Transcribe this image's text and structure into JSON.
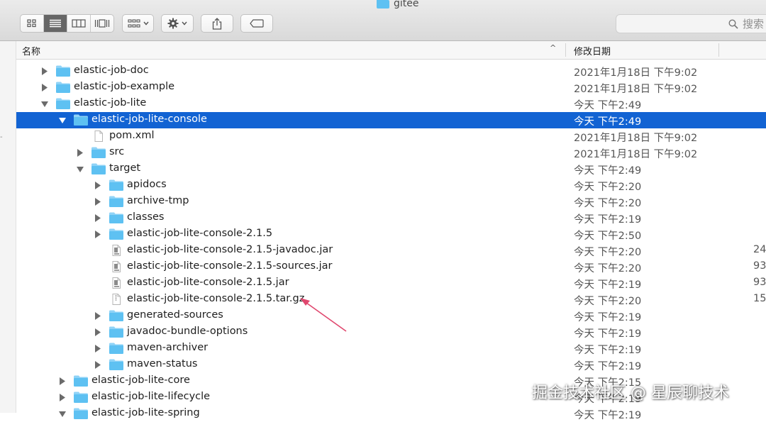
{
  "window": {
    "title": "gitee"
  },
  "toolbar": {
    "view_buttons": [
      {
        "name": "icon-view-button",
        "icon": "grid-icon",
        "active": false
      },
      {
        "name": "list-view-button",
        "icon": "list-icon",
        "active": true
      },
      {
        "name": "column-view-button",
        "icon": "columns-icon",
        "active": false
      },
      {
        "name": "gallery-view-button",
        "icon": "gallery-icon",
        "active": false
      }
    ],
    "group_button_icon": "group-icon",
    "action_button_icon": "gear-icon",
    "share_button_icon": "share-icon",
    "tag_button_icon": "tag-icon"
  },
  "search": {
    "placeholder": "搜索"
  },
  "header": {
    "name_label": "名称",
    "date_label": "修改日期",
    "sort_indicator": "^"
  },
  "colors": {
    "selection": "#1263d3",
    "folder": "#5ec1f2",
    "folder_tab": "#8fd3f7"
  },
  "rows": [
    {
      "name": "elastic-job-doc",
      "date": "2021年1月18日 下午9:02",
      "kind": "folder",
      "depth": 0,
      "disclosure": "collapsed",
      "selected": false,
      "size": ""
    },
    {
      "name": "elastic-job-example",
      "date": "2021年1月18日 下午9:02",
      "kind": "folder",
      "depth": 0,
      "disclosure": "collapsed",
      "selected": false,
      "size": ""
    },
    {
      "name": "elastic-job-lite",
      "date": "今天 下午2:49",
      "kind": "folder",
      "depth": 0,
      "disclosure": "expanded",
      "selected": false,
      "size": ""
    },
    {
      "name": "elastic-job-lite-console",
      "date": "今天 下午2:49",
      "kind": "folder",
      "depth": 1,
      "disclosure": "expanded",
      "selected": true,
      "size": ""
    },
    {
      "name": "pom.xml",
      "date": "2021年1月18日 下午9:02",
      "kind": "file",
      "depth": 2,
      "disclosure": "none",
      "selected": false,
      "size": ""
    },
    {
      "name": "src",
      "date": "2021年1月18日 下午9:02",
      "kind": "folder",
      "depth": 2,
      "disclosure": "collapsed",
      "selected": false,
      "size": ""
    },
    {
      "name": "target",
      "date": "今天 下午2:49",
      "kind": "folder",
      "depth": 2,
      "disclosure": "expanded",
      "selected": false,
      "size": ""
    },
    {
      "name": "apidocs",
      "date": "今天 下午2:20",
      "kind": "folder",
      "depth": 3,
      "disclosure": "collapsed",
      "selected": false,
      "size": ""
    },
    {
      "name": "archive-tmp",
      "date": "今天 下午2:20",
      "kind": "folder",
      "depth": 3,
      "disclosure": "collapsed",
      "selected": false,
      "size": ""
    },
    {
      "name": "classes",
      "date": "今天 下午2:19",
      "kind": "folder",
      "depth": 3,
      "disclosure": "collapsed",
      "selected": false,
      "size": ""
    },
    {
      "name": "elastic-job-lite-console-2.1.5",
      "date": "今天 下午2:50",
      "kind": "folder",
      "depth": 3,
      "disclosure": "collapsed",
      "selected": false,
      "size": ""
    },
    {
      "name": "elastic-job-lite-console-2.1.5-javadoc.jar",
      "date": "今天 下午2:20",
      "kind": "jar",
      "depth": 3,
      "disclosure": "none",
      "selected": false,
      "size": "24"
    },
    {
      "name": "elastic-job-lite-console-2.1.5-sources.jar",
      "date": "今天 下午2:20",
      "kind": "jar",
      "depth": 3,
      "disclosure": "none",
      "selected": false,
      "size": "93"
    },
    {
      "name": "elastic-job-lite-console-2.1.5.jar",
      "date": "今天 下午2:19",
      "kind": "jar",
      "depth": 3,
      "disclosure": "none",
      "selected": false,
      "size": "93"
    },
    {
      "name": "elastic-job-lite-console-2.1.5.tar.gz",
      "date": "今天 下午2:20",
      "kind": "archive",
      "depth": 3,
      "disclosure": "none",
      "selected": false,
      "size": "15."
    },
    {
      "name": "generated-sources",
      "date": "今天 下午2:19",
      "kind": "folder",
      "depth": 3,
      "disclosure": "collapsed",
      "selected": false,
      "size": ""
    },
    {
      "name": "javadoc-bundle-options",
      "date": "今天 下午2:19",
      "kind": "folder",
      "depth": 3,
      "disclosure": "collapsed",
      "selected": false,
      "size": ""
    },
    {
      "name": "maven-archiver",
      "date": "今天 下午2:19",
      "kind": "folder",
      "depth": 3,
      "disclosure": "collapsed",
      "selected": false,
      "size": ""
    },
    {
      "name": "maven-status",
      "date": "今天 下午2:19",
      "kind": "folder",
      "depth": 3,
      "disclosure": "collapsed",
      "selected": false,
      "size": ""
    },
    {
      "name": "elastic-job-lite-core",
      "date": "今天 下午2:15",
      "kind": "folder",
      "depth": 1,
      "disclosure": "collapsed",
      "selected": false,
      "size": ""
    },
    {
      "name": "elastic-job-lite-lifecycle",
      "date": "今天 下午2:19",
      "kind": "folder",
      "depth": 1,
      "disclosure": "collapsed",
      "selected": false,
      "size": ""
    },
    {
      "name": "elastic-job-lite-spring",
      "date": "今天 下午2:19",
      "kind": "folder",
      "depth": 1,
      "disclosure": "expanded",
      "selected": false,
      "size": ""
    }
  ],
  "watermark": {
    "text": "掘金技术社区 @ 星辰聊技术"
  }
}
